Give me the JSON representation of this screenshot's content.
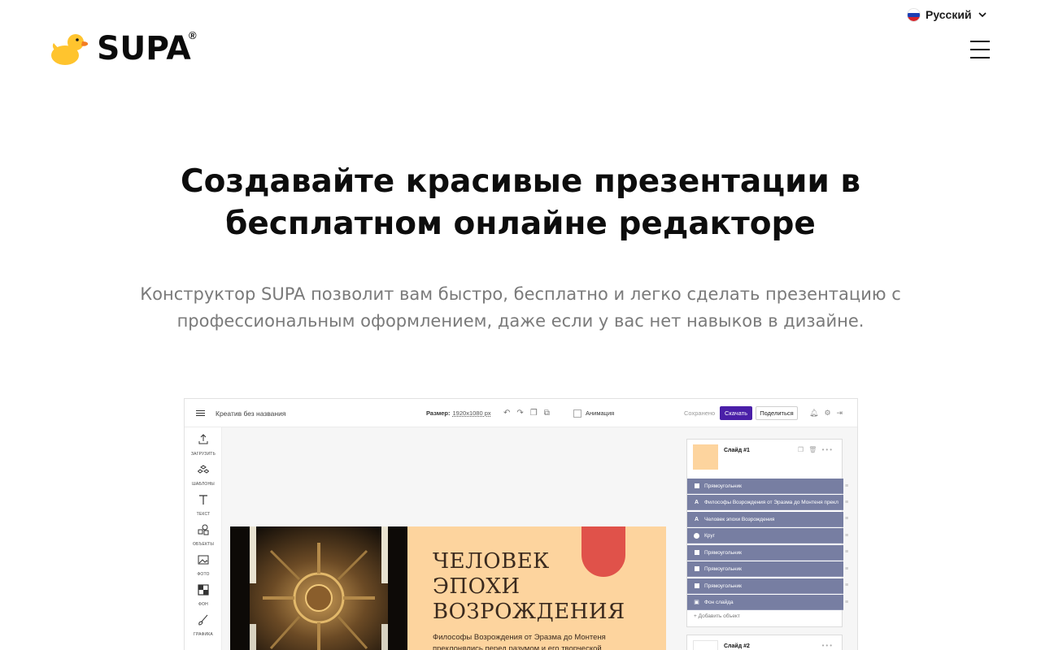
{
  "header": {
    "language": "Русский",
    "logo_text": "SUPA",
    "logo_mark": "®"
  },
  "hero": {
    "title_line1": "Создавайте красивые презентации в",
    "title_line2": "бесплатном онлайне редакторе",
    "subtitle": "Конструктор SUPA позволит вам быстро, бесплатно и легко сделать презентацию с профессиональным оформлением, даже если у вас нет навыков в дизайне."
  },
  "editor": {
    "doc_title": "Креатив без названия",
    "size_label": "Размер:",
    "size_value": "1920x1080 px",
    "animation_label": "Анимация",
    "saved_label": "Сохранено",
    "download_label": "Скачать",
    "share_label": "Поделиться",
    "sidebar": [
      {
        "label": "ЗАГРУЗИТЬ",
        "icon": "upload-icon"
      },
      {
        "label": "ШАБЛОНЫ",
        "icon": "templates-icon"
      },
      {
        "label": "ТЕКСТ",
        "icon": "text-icon"
      },
      {
        "label": "ОБЪЕКТЫ",
        "icon": "objects-icon"
      },
      {
        "label": "ФОТО",
        "icon": "photo-icon"
      },
      {
        "label": "ФОН",
        "icon": "background-icon"
      },
      {
        "label": "ГРАФИКА",
        "icon": "brush-icon"
      }
    ],
    "slide": {
      "title_line1": "ЧЕЛОВЕК",
      "title_line2": "ЭПОХИ",
      "title_line3": "ВОЗРОЖДЕНИЯ",
      "text": "Философы Возрождения от Эразма до Монтеня преклонялись перед разумом и его творческой"
    },
    "layers_panel": {
      "slide1_name": "Слайд #1",
      "slide2_name": "Слайд #2",
      "add_object": "Добавить объект",
      "layers": [
        {
          "label": "Прямоугольник",
          "icon": "square-icon"
        },
        {
          "label": "Философы Возрождения от Эразма до Монтеня прекл",
          "icon": "text-a-icon"
        },
        {
          "label": "Человек эпохи Возрождения",
          "icon": "text-a-icon"
        },
        {
          "label": "Круг",
          "icon": "circle-icon"
        },
        {
          "label": "Прямоугольник",
          "icon": "square-icon"
        },
        {
          "label": "Прямоугольник",
          "icon": "square-icon"
        },
        {
          "label": "Прямоугольник",
          "icon": "square-icon"
        },
        {
          "label": "Фон слайда",
          "icon": "background-icon"
        }
      ]
    }
  },
  "colors": {
    "accent": "#4a1fa8",
    "layer_bg": "#777ea2",
    "slide_bg": "#fdd49e",
    "slide_circle": "#e0524a",
    "duck_yellow": "#ffc42e",
    "duck_beak": "#f37d22"
  }
}
